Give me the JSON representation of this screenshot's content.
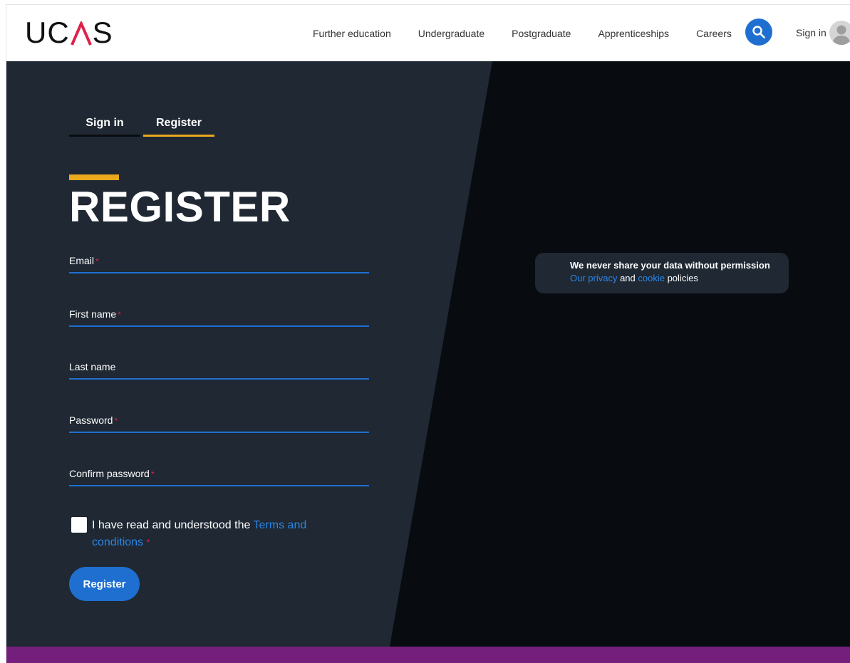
{
  "header": {
    "logo_text_left": "UC",
    "logo_text_right": "S",
    "nav": [
      "Further education",
      "Undergraduate",
      "Postgraduate",
      "Apprenticeships",
      "Careers"
    ],
    "sign_in": "Sign in"
  },
  "tabs": {
    "sign_in": "Sign in",
    "register": "Register"
  },
  "form": {
    "title": "REGISTER",
    "fields": [
      {
        "label": "Email",
        "required": "*"
      },
      {
        "label": "First name",
        "required": "*"
      },
      {
        "label": "Last name",
        "required": ""
      },
      {
        "label": "Password",
        "required": "*"
      },
      {
        "label": "Confirm password",
        "required": "*"
      }
    ],
    "terms_prefix": "I have read and understood the ",
    "terms_link": "Terms and conditions",
    "terms_required": "*",
    "submit": "Register"
  },
  "privacy": {
    "headline": "We never share your data without permission",
    "link_privacy": "Our privacy",
    "and": " and ",
    "link_cookie": "cookie",
    "suffix": " policies"
  },
  "colors": {
    "accent_blue": "#1f6fd1",
    "accent_yellow": "#e9a81d",
    "footer_purple": "#741f7c",
    "required_red": "#e0204a"
  }
}
